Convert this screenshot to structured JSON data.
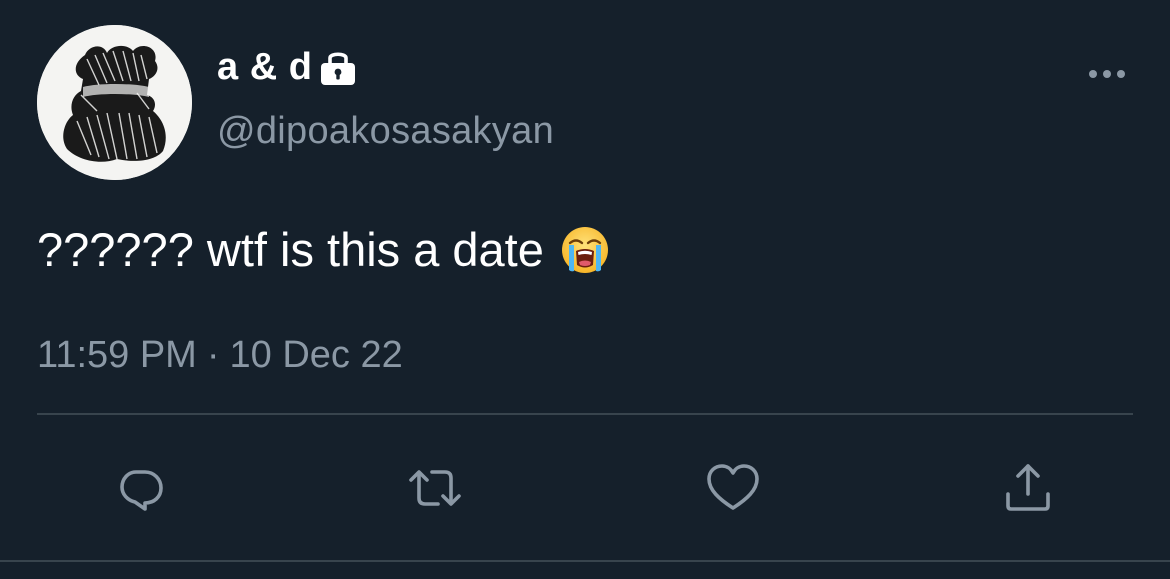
{
  "tweet": {
    "display_name": "a & d",
    "handle": "@dipoakosasakyan",
    "text": "?????? wtf is this a date",
    "time": "11:59 PM",
    "separator": "·",
    "date": "10 Dec 22"
  },
  "icons": {
    "lock": "lock-icon",
    "more": "more-horizontal-icon",
    "emoji": "loudly-crying-face-emoji",
    "reply": "reply-icon",
    "retweet": "retweet-icon",
    "like": "heart-icon",
    "share": "share-icon"
  },
  "colors": {
    "background": "#15202b",
    "text_primary": "#ffffff",
    "text_secondary": "#8b98a5",
    "divider": "#38444d"
  }
}
